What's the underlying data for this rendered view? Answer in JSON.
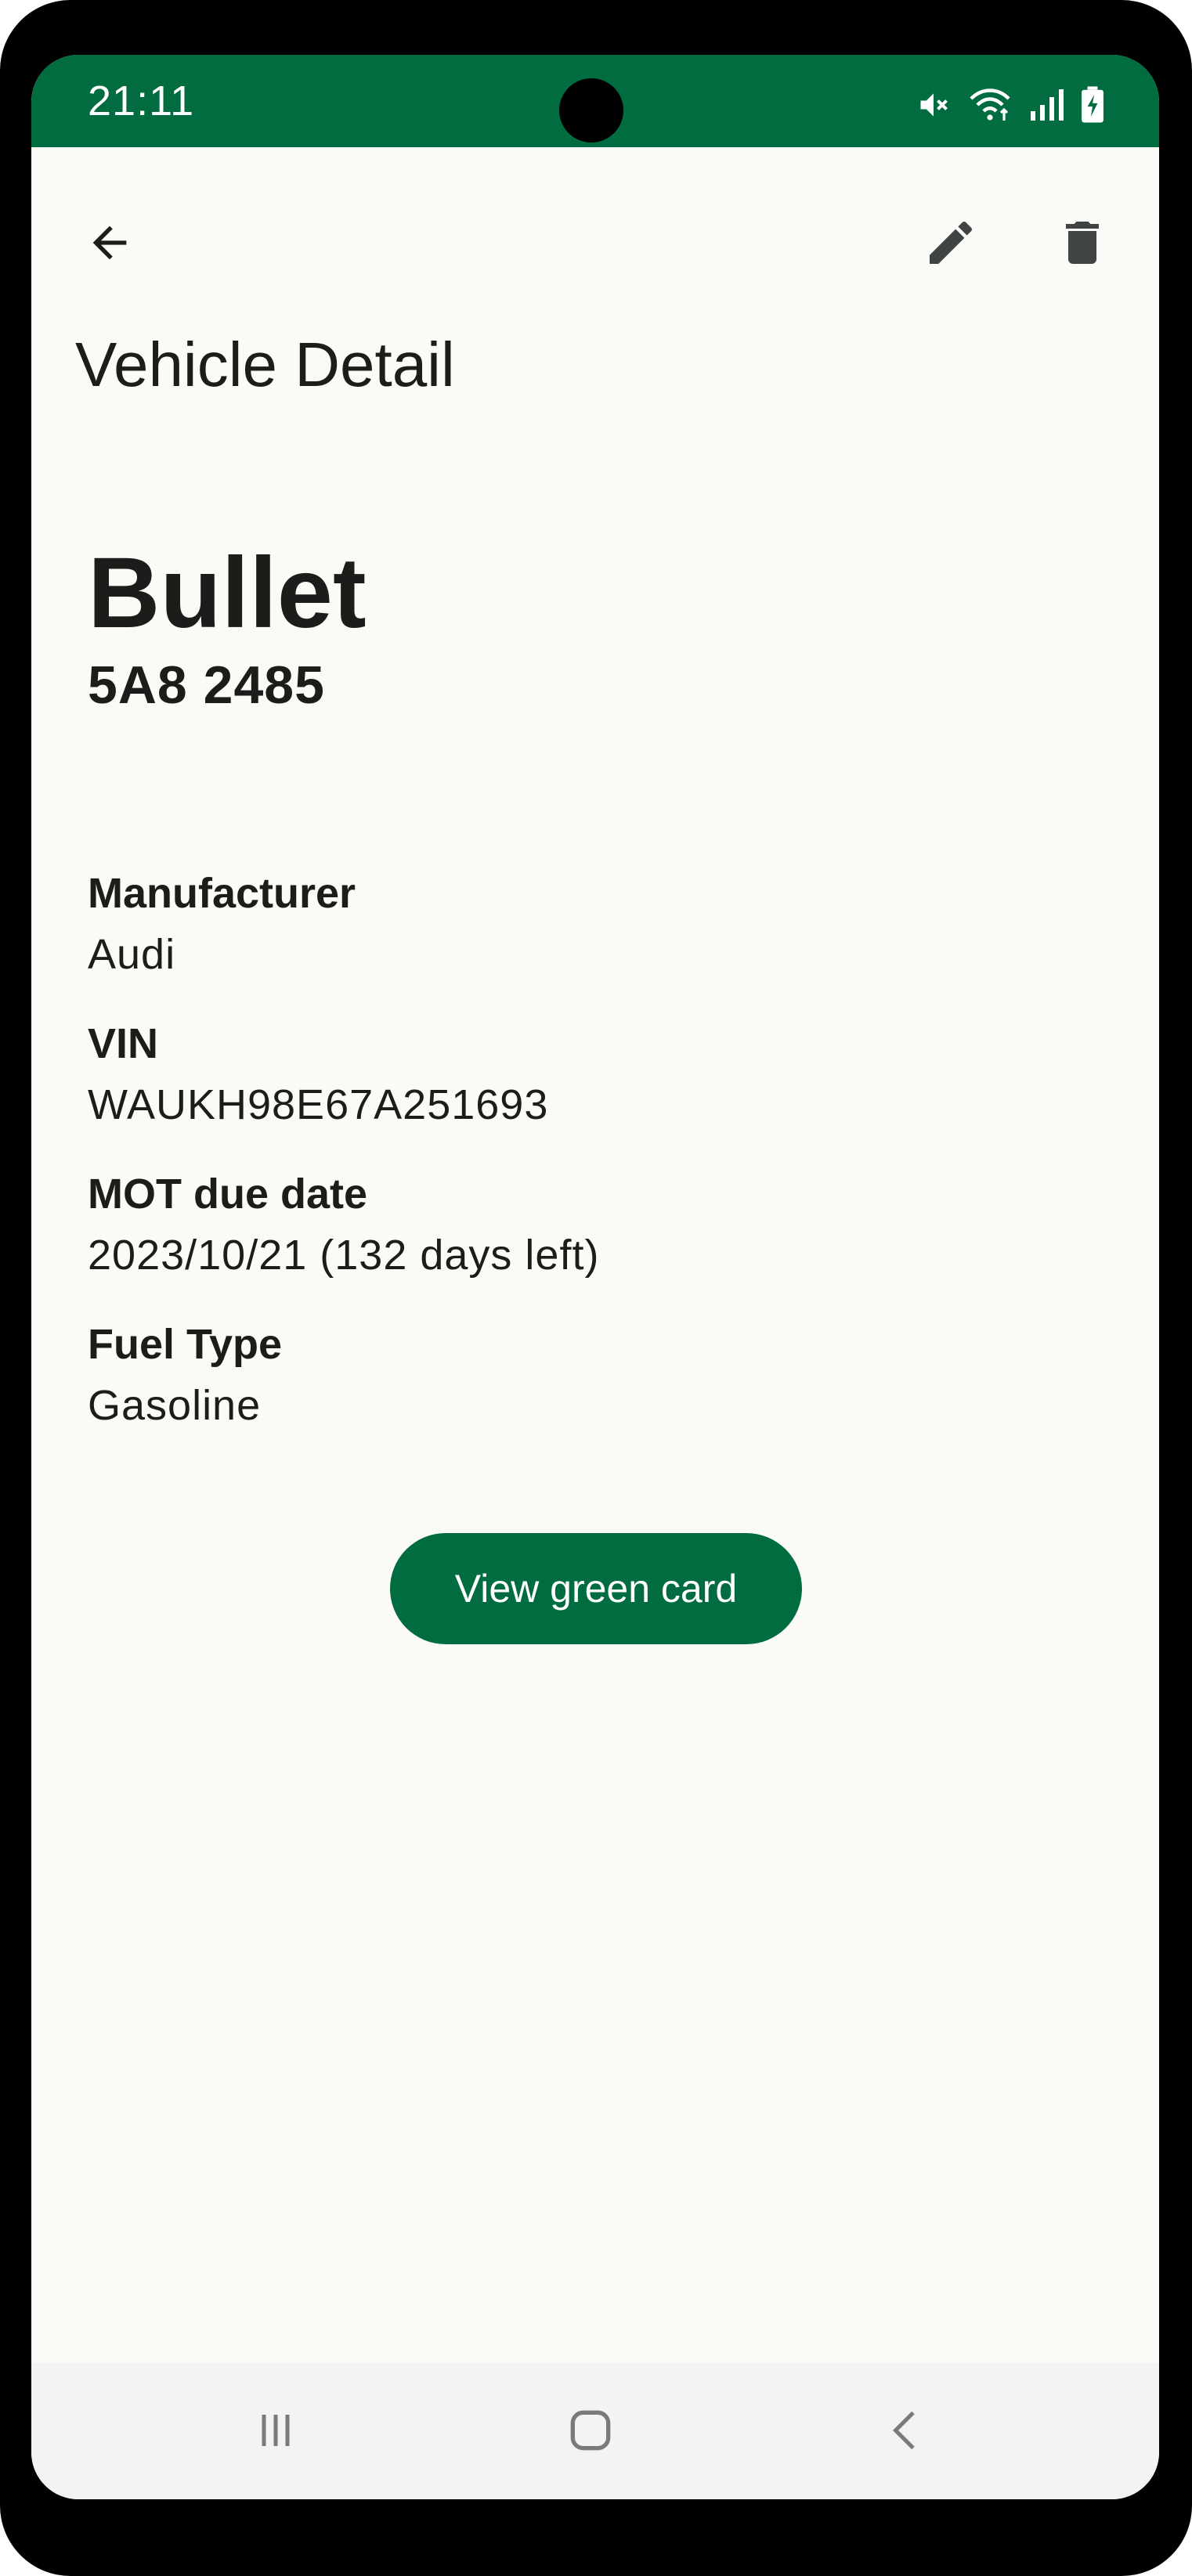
{
  "status_bar": {
    "time": "21:11",
    "icons": [
      "mute-icon",
      "wifi-icon",
      "signal-icon",
      "battery-charging-icon"
    ]
  },
  "app_bar": {
    "back_icon": "arrow-back-icon",
    "edit_icon": "pencil-icon",
    "delete_icon": "trash-icon"
  },
  "page": {
    "title": "Vehicle Detail"
  },
  "vehicle": {
    "name": "Bullet",
    "plate": "5A8 2485",
    "fields": [
      {
        "label": "Manufacturer",
        "value": "Audi"
      },
      {
        "label": "VIN",
        "value": "WAUKH98E67A251693"
      },
      {
        "label": "MOT due date",
        "value": "2023/10/21 (132 days left)"
      },
      {
        "label": "Fuel Type",
        "value": "Gasoline"
      }
    ]
  },
  "actions": {
    "green_card_label": "View green card"
  },
  "nav_bar": {
    "icons": [
      "recents-icon",
      "home-icon",
      "back-icon"
    ]
  },
  "colors": {
    "accent": "#006c3f",
    "background": "#fafbf7",
    "text": "#1c1c1a",
    "nav_background": "#f3f3f3"
  }
}
